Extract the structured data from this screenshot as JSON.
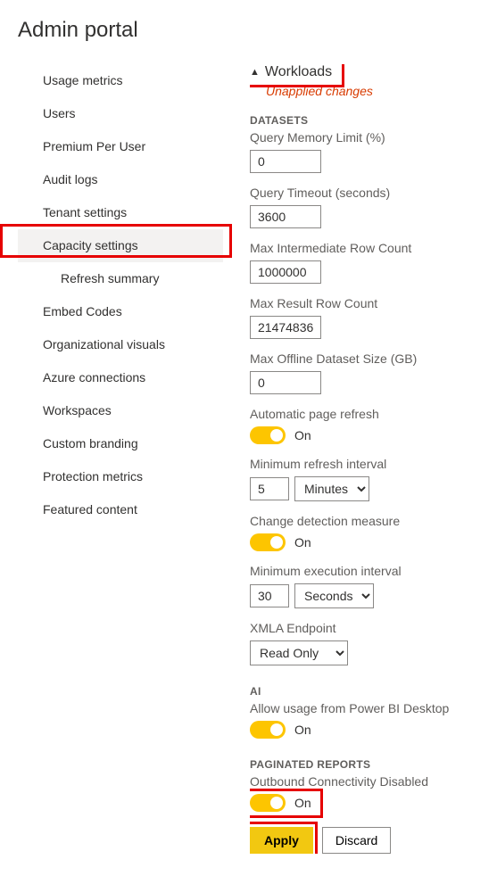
{
  "page_title": "Admin portal",
  "sidebar": {
    "items": [
      {
        "label": "Usage metrics"
      },
      {
        "label": "Users"
      },
      {
        "label": "Premium Per User"
      },
      {
        "label": "Audit logs"
      },
      {
        "label": "Tenant settings"
      },
      {
        "label": "Capacity settings"
      },
      {
        "label": "Refresh summary"
      },
      {
        "label": "Embed Codes"
      },
      {
        "label": "Organizational visuals"
      },
      {
        "label": "Azure connections"
      },
      {
        "label": "Workspaces"
      },
      {
        "label": "Custom branding"
      },
      {
        "label": "Protection metrics"
      },
      {
        "label": "Featured content"
      }
    ]
  },
  "workloads": {
    "header": "Workloads",
    "unapplied": "Unapplied changes",
    "datasets": {
      "group_label": "DATASETS",
      "query_memory_label": "Query Memory Limit (%)",
      "query_memory_value": "0",
      "query_timeout_label": "Query Timeout (seconds)",
      "query_timeout_value": "3600",
      "max_intermediate_label": "Max Intermediate Row Count",
      "max_intermediate_value": "1000000",
      "max_result_label": "Max Result Row Count",
      "max_result_value": "21474836",
      "max_offline_label": "Max Offline Dataset Size (GB)",
      "max_offline_value": "0",
      "auto_refresh_label": "Automatic page refresh",
      "auto_refresh_state": "On",
      "min_refresh_label": "Minimum refresh interval",
      "min_refresh_value": "5",
      "min_refresh_unit": "Minutes",
      "change_detection_label": "Change detection measure",
      "change_detection_state": "On",
      "min_execution_label": "Minimum execution interval",
      "min_execution_value": "30",
      "min_execution_unit": "Seconds",
      "xmla_label": "XMLA Endpoint",
      "xmla_value": "Read Only"
    },
    "ai": {
      "group_label": "AI",
      "allow_desktop_label": "Allow usage from Power BI Desktop",
      "allow_desktop_state": "On"
    },
    "paginated": {
      "group_label": "PAGINATED REPORTS",
      "outbound_label": "Outbound Connectivity Disabled",
      "outbound_state": "On"
    },
    "apply_label": "Apply",
    "discard_label": "Discard"
  }
}
